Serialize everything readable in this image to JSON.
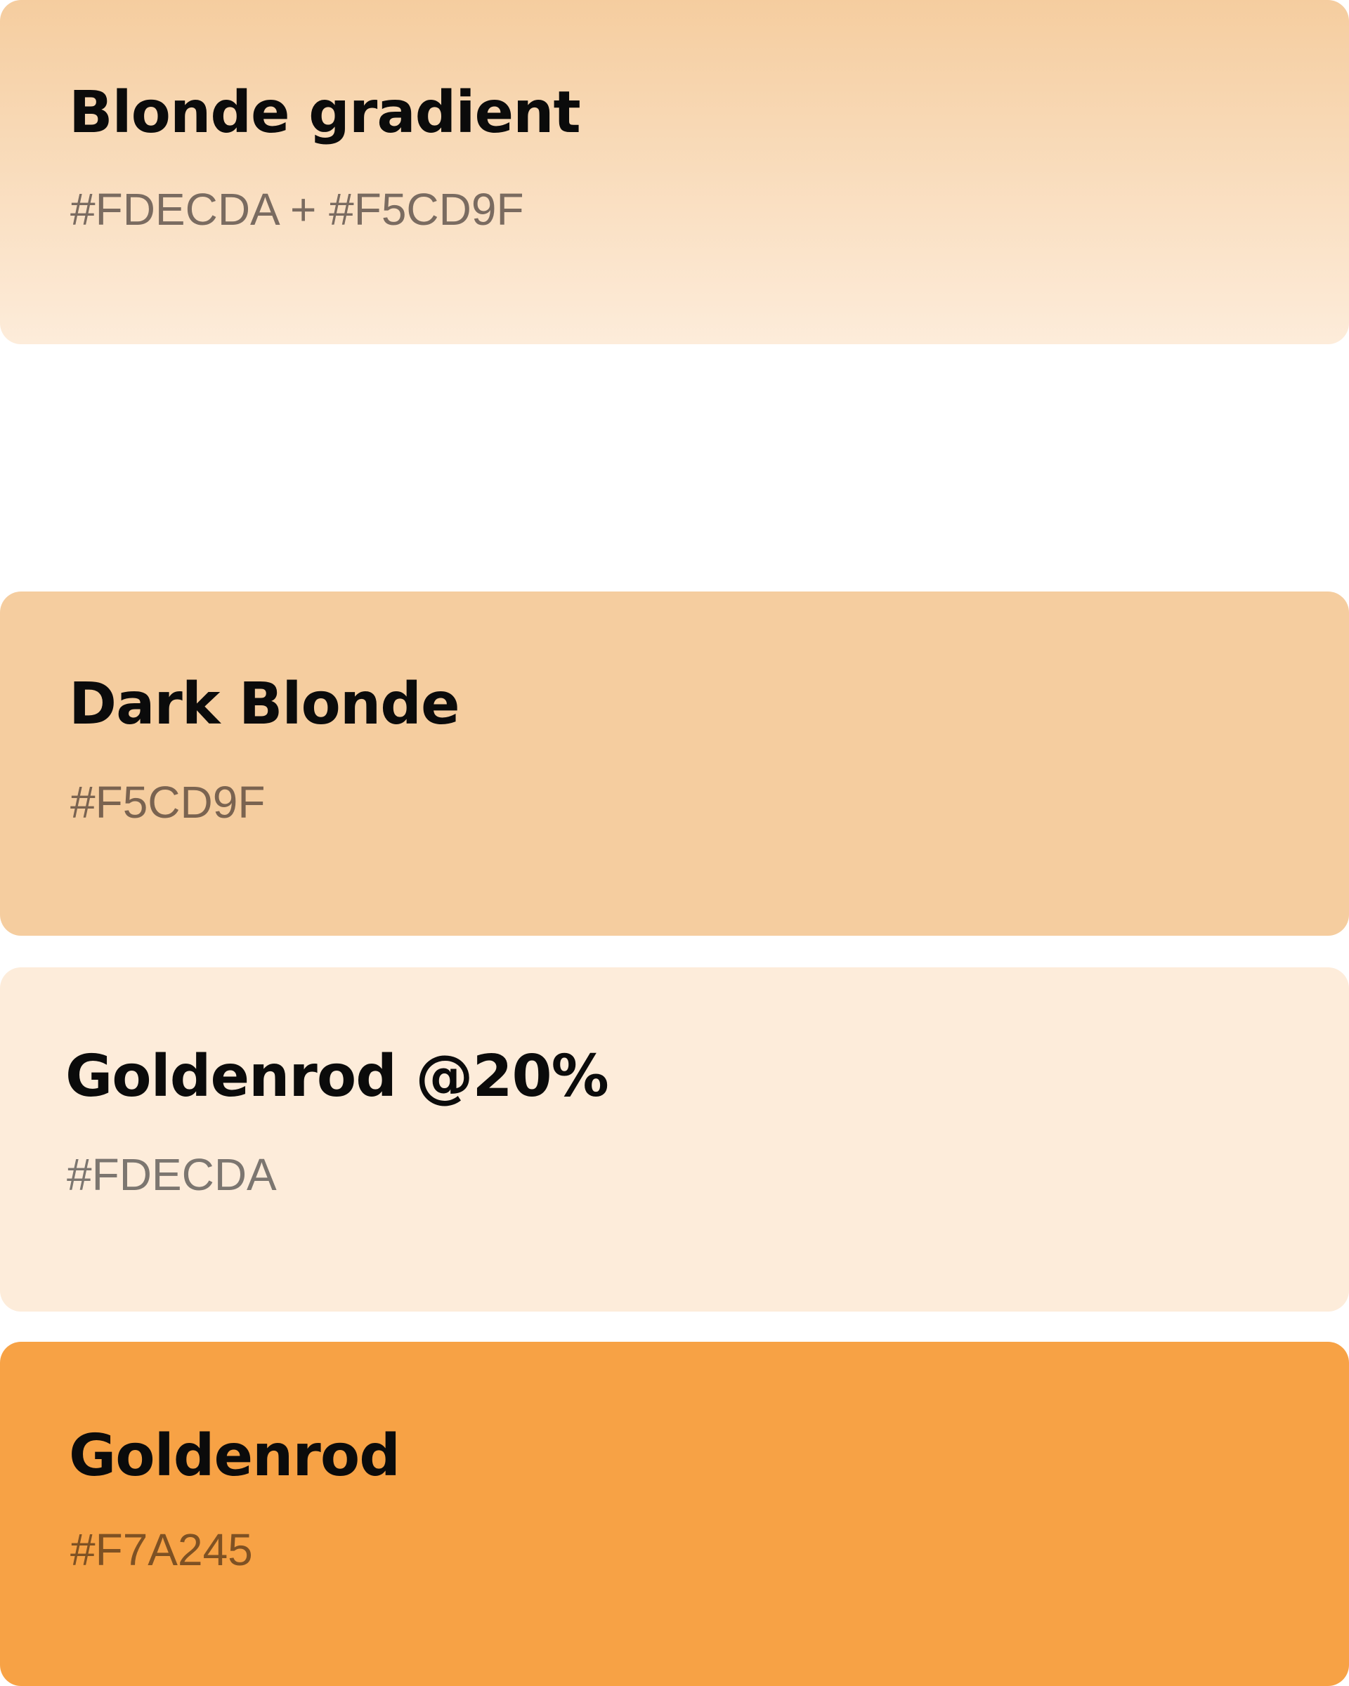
{
  "swatches": [
    {
      "name": "Blonde gradient",
      "hex": "#FDECDA + #F5CD9F",
      "fill_top": "#F5CD9F",
      "fill_bottom": "#FDECDA",
      "text_color": "#7A6B60"
    },
    {
      "name": "Dark Blonde",
      "hex": "#F5CD9F",
      "fill": "#F5CD9F",
      "text_color": "#7A6350"
    },
    {
      "name": "Goldenrod @20%",
      "hex": "#FDECDA",
      "fill": "#FDECDA",
      "text_color": "#7C7670"
    },
    {
      "name": "Goldenrod",
      "hex": "#F7A245",
      "fill": "#F7A245",
      "text_color": "#7E5123"
    }
  ]
}
